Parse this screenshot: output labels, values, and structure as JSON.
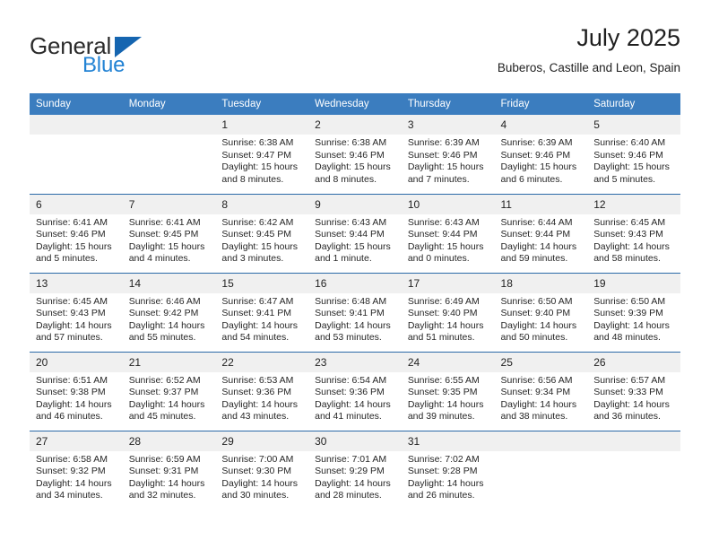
{
  "brand": {
    "name_top": "General",
    "name_bottom": "Blue",
    "accent_color": "#2383d4",
    "triangle_color": "#1565b0"
  },
  "header": {
    "title": "July 2025",
    "subtitle": "Buberos, Castille and Leon, Spain"
  },
  "calendar": {
    "header_bg": "#3b7dbf",
    "row_border_color": "#2b6aa8",
    "daynum_bg": "#f0f0f0",
    "weekday_headers": [
      "Sunday",
      "Monday",
      "Tuesday",
      "Wednesday",
      "Thursday",
      "Friday",
      "Saturday"
    ],
    "weeks": [
      [
        {
          "day": "",
          "sunrise": "",
          "sunset": "",
          "daylight": "",
          "empty": true
        },
        {
          "day": "",
          "sunrise": "",
          "sunset": "",
          "daylight": "",
          "empty": true
        },
        {
          "day": "1",
          "sunrise": "Sunrise: 6:38 AM",
          "sunset": "Sunset: 9:47 PM",
          "daylight": "Daylight: 15 hours and 8 minutes."
        },
        {
          "day": "2",
          "sunrise": "Sunrise: 6:38 AM",
          "sunset": "Sunset: 9:46 PM",
          "daylight": "Daylight: 15 hours and 8 minutes."
        },
        {
          "day": "3",
          "sunrise": "Sunrise: 6:39 AM",
          "sunset": "Sunset: 9:46 PM",
          "daylight": "Daylight: 15 hours and 7 minutes."
        },
        {
          "day": "4",
          "sunrise": "Sunrise: 6:39 AM",
          "sunset": "Sunset: 9:46 PM",
          "daylight": "Daylight: 15 hours and 6 minutes."
        },
        {
          "day": "5",
          "sunrise": "Sunrise: 6:40 AM",
          "sunset": "Sunset: 9:46 PM",
          "daylight": "Daylight: 15 hours and 5 minutes."
        }
      ],
      [
        {
          "day": "6",
          "sunrise": "Sunrise: 6:41 AM",
          "sunset": "Sunset: 9:46 PM",
          "daylight": "Daylight: 15 hours and 5 minutes."
        },
        {
          "day": "7",
          "sunrise": "Sunrise: 6:41 AM",
          "sunset": "Sunset: 9:45 PM",
          "daylight": "Daylight: 15 hours and 4 minutes."
        },
        {
          "day": "8",
          "sunrise": "Sunrise: 6:42 AM",
          "sunset": "Sunset: 9:45 PM",
          "daylight": "Daylight: 15 hours and 3 minutes."
        },
        {
          "day": "9",
          "sunrise": "Sunrise: 6:43 AM",
          "sunset": "Sunset: 9:44 PM",
          "daylight": "Daylight: 15 hours and 1 minute."
        },
        {
          "day": "10",
          "sunrise": "Sunrise: 6:43 AM",
          "sunset": "Sunset: 9:44 PM",
          "daylight": "Daylight: 15 hours and 0 minutes."
        },
        {
          "day": "11",
          "sunrise": "Sunrise: 6:44 AM",
          "sunset": "Sunset: 9:44 PM",
          "daylight": "Daylight: 14 hours and 59 minutes."
        },
        {
          "day": "12",
          "sunrise": "Sunrise: 6:45 AM",
          "sunset": "Sunset: 9:43 PM",
          "daylight": "Daylight: 14 hours and 58 minutes."
        }
      ],
      [
        {
          "day": "13",
          "sunrise": "Sunrise: 6:45 AM",
          "sunset": "Sunset: 9:43 PM",
          "daylight": "Daylight: 14 hours and 57 minutes."
        },
        {
          "day": "14",
          "sunrise": "Sunrise: 6:46 AM",
          "sunset": "Sunset: 9:42 PM",
          "daylight": "Daylight: 14 hours and 55 minutes."
        },
        {
          "day": "15",
          "sunrise": "Sunrise: 6:47 AM",
          "sunset": "Sunset: 9:41 PM",
          "daylight": "Daylight: 14 hours and 54 minutes."
        },
        {
          "day": "16",
          "sunrise": "Sunrise: 6:48 AM",
          "sunset": "Sunset: 9:41 PM",
          "daylight": "Daylight: 14 hours and 53 minutes."
        },
        {
          "day": "17",
          "sunrise": "Sunrise: 6:49 AM",
          "sunset": "Sunset: 9:40 PM",
          "daylight": "Daylight: 14 hours and 51 minutes."
        },
        {
          "day": "18",
          "sunrise": "Sunrise: 6:50 AM",
          "sunset": "Sunset: 9:40 PM",
          "daylight": "Daylight: 14 hours and 50 minutes."
        },
        {
          "day": "19",
          "sunrise": "Sunrise: 6:50 AM",
          "sunset": "Sunset: 9:39 PM",
          "daylight": "Daylight: 14 hours and 48 minutes."
        }
      ],
      [
        {
          "day": "20",
          "sunrise": "Sunrise: 6:51 AM",
          "sunset": "Sunset: 9:38 PM",
          "daylight": "Daylight: 14 hours and 46 minutes."
        },
        {
          "day": "21",
          "sunrise": "Sunrise: 6:52 AM",
          "sunset": "Sunset: 9:37 PM",
          "daylight": "Daylight: 14 hours and 45 minutes."
        },
        {
          "day": "22",
          "sunrise": "Sunrise: 6:53 AM",
          "sunset": "Sunset: 9:36 PM",
          "daylight": "Daylight: 14 hours and 43 minutes."
        },
        {
          "day": "23",
          "sunrise": "Sunrise: 6:54 AM",
          "sunset": "Sunset: 9:36 PM",
          "daylight": "Daylight: 14 hours and 41 minutes."
        },
        {
          "day": "24",
          "sunrise": "Sunrise: 6:55 AM",
          "sunset": "Sunset: 9:35 PM",
          "daylight": "Daylight: 14 hours and 39 minutes."
        },
        {
          "day": "25",
          "sunrise": "Sunrise: 6:56 AM",
          "sunset": "Sunset: 9:34 PM",
          "daylight": "Daylight: 14 hours and 38 minutes."
        },
        {
          "day": "26",
          "sunrise": "Sunrise: 6:57 AM",
          "sunset": "Sunset: 9:33 PM",
          "daylight": "Daylight: 14 hours and 36 minutes."
        }
      ],
      [
        {
          "day": "27",
          "sunrise": "Sunrise: 6:58 AM",
          "sunset": "Sunset: 9:32 PM",
          "daylight": "Daylight: 14 hours and 34 minutes."
        },
        {
          "day": "28",
          "sunrise": "Sunrise: 6:59 AM",
          "sunset": "Sunset: 9:31 PM",
          "daylight": "Daylight: 14 hours and 32 minutes."
        },
        {
          "day": "29",
          "sunrise": "Sunrise: 7:00 AM",
          "sunset": "Sunset: 9:30 PM",
          "daylight": "Daylight: 14 hours and 30 minutes."
        },
        {
          "day": "30",
          "sunrise": "Sunrise: 7:01 AM",
          "sunset": "Sunset: 9:29 PM",
          "daylight": "Daylight: 14 hours and 28 minutes."
        },
        {
          "day": "31",
          "sunrise": "Sunrise: 7:02 AM",
          "sunset": "Sunset: 9:28 PM",
          "daylight": "Daylight: 14 hours and 26 minutes."
        },
        {
          "day": "",
          "sunrise": "",
          "sunset": "",
          "daylight": "",
          "empty": true
        },
        {
          "day": "",
          "sunrise": "",
          "sunset": "",
          "daylight": "",
          "empty": true
        }
      ]
    ]
  }
}
